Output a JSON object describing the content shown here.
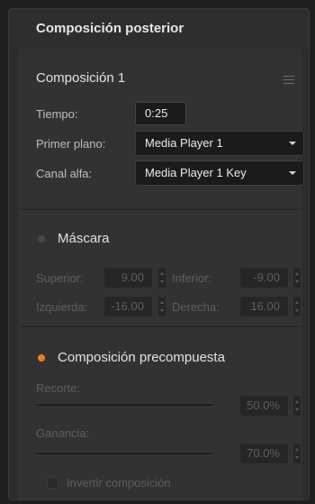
{
  "panel": {
    "title": "Composición posterior"
  },
  "composition": {
    "title": "Composición 1",
    "menu_icon": "hamburger-menu-icon",
    "time": {
      "label": "Tiempo:",
      "value": "0:25"
    },
    "foreground": {
      "label": "Primer plano:",
      "value": "Media Player 1"
    },
    "alpha": {
      "label": "Canal alfa:",
      "value": "Media Player 1 Key"
    }
  },
  "mask": {
    "title": "Máscara",
    "enabled": false,
    "top": {
      "label": "Superior:",
      "value": "9.00"
    },
    "bottom": {
      "label": "Inferior:",
      "value": "-9.00"
    },
    "left": {
      "label": "Izquierda:",
      "value": "-16.00"
    },
    "right": {
      "label": "Derecha:",
      "value": "16.00"
    }
  },
  "premultiplied": {
    "title": "Composición precompuesta",
    "enabled": true,
    "clip": {
      "label": "Recorte:",
      "value": "50.0%"
    },
    "gain": {
      "label": "Ganancia:",
      "value": "70.0%"
    },
    "invert": {
      "label": "Invertir composición",
      "checked": false
    }
  },
  "colors": {
    "accent": "#e8811f",
    "panel_bg": "#2c2c2c",
    "section_bg": "#323232",
    "field_bg": "#1b1b1b",
    "disabled_text": "#5e5e5e"
  }
}
